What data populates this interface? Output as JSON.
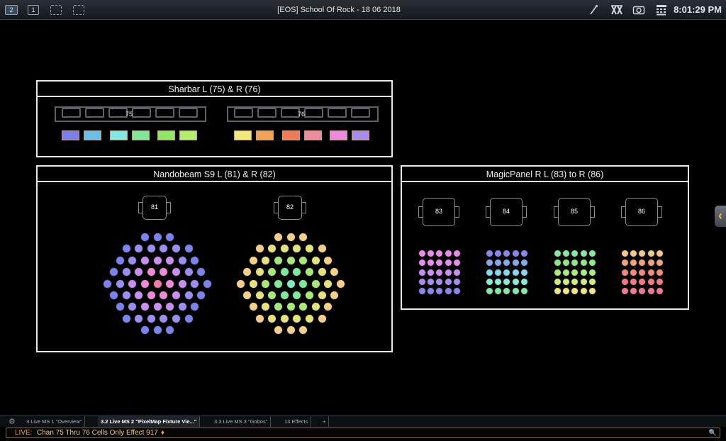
{
  "topbar": {
    "workspaces": [
      "2",
      "1"
    ],
    "title": "[EOS] School Of Rock - 18 06 2018",
    "clock": "8:01:29 PM",
    "icons": [
      "wand-icon",
      "network-icon",
      "camera-icon",
      "keypad-icon"
    ]
  },
  "sharbar": {
    "title": "Sharbar L (75) & R (76)",
    "left_label": "75",
    "right_label": "76",
    "left_colors": [
      "#7b7df0",
      "#6bbef0",
      "#7fe8e8",
      "#7de89a",
      "#8ee868",
      "#b0ef6e"
    ],
    "right_colors": [
      "#f0ea7a",
      "#f2a35a",
      "#f07a5a",
      "#f08aa0",
      "#ee88e0",
      "#a88cf0"
    ]
  },
  "nandobeam": {
    "title": "Nandobeam S9 L (81) & R (82)",
    "left_label": "81",
    "right_label": "82"
  },
  "magicpanel": {
    "title": "MagicPanel R L (83) to R (86)",
    "labels": [
      "83",
      "84",
      "85",
      "86"
    ]
  },
  "tabs": [
    {
      "label": "3 Live MS 1 \"Overview\"",
      "active": false
    },
    {
      "label": "3.2 Live MS 2 \"PixelMap Fixture Vie...\"",
      "active": true
    },
    {
      "label": "3.3 Live MS 3 \"Gobos\"",
      "active": false
    },
    {
      "label": "13 Effects",
      "active": false
    },
    {
      "label": "+",
      "active": false
    }
  ],
  "command_line": {
    "prefix": "LIVE:",
    "text": "Chan 75 Thru 76 Cells Only Effect 917",
    "end_marker": "♦"
  }
}
